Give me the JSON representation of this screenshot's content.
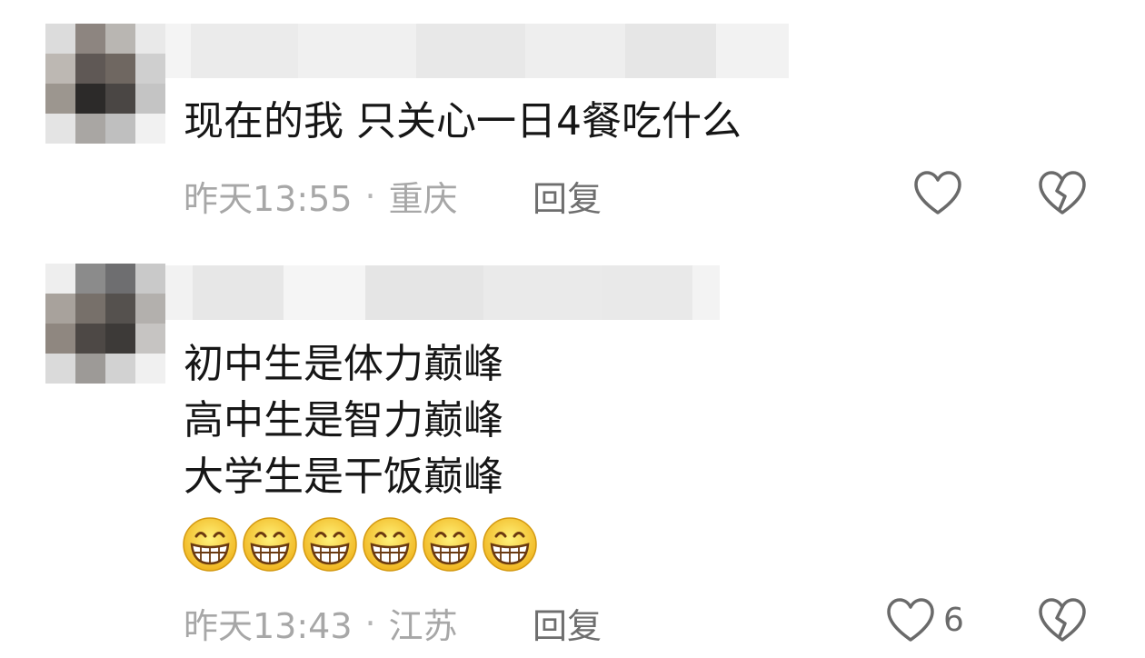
{
  "comments": [
    {
      "text_lines": [
        "现在的我  只关心一日4餐吃什么"
      ],
      "time": "昨天13:55",
      "separator": "·",
      "location": "重庆",
      "reply_label": "回复",
      "like_count": ""
    },
    {
      "text_lines": [
        "初中生是体力巅峰",
        "高中生是智力巅峰",
        "大学生是干饭巅峰"
      ],
      "emojis": [
        "grin-emoji",
        "grin-emoji",
        "grin-emoji",
        "grin-emoji",
        "grin-emoji",
        "grin-emoji"
      ],
      "time": "昨天13:43",
      "separator": "·",
      "location": "江苏",
      "reply_label": "回复",
      "like_count": "6"
    }
  ],
  "icons": {
    "like": "heart-outline-icon",
    "dislike": "broken-heart-icon"
  },
  "colors": {
    "meta_text": "#a7a7a7",
    "reply_text": "#6e6e6e",
    "icon_stroke": "#6a6a6a"
  }
}
